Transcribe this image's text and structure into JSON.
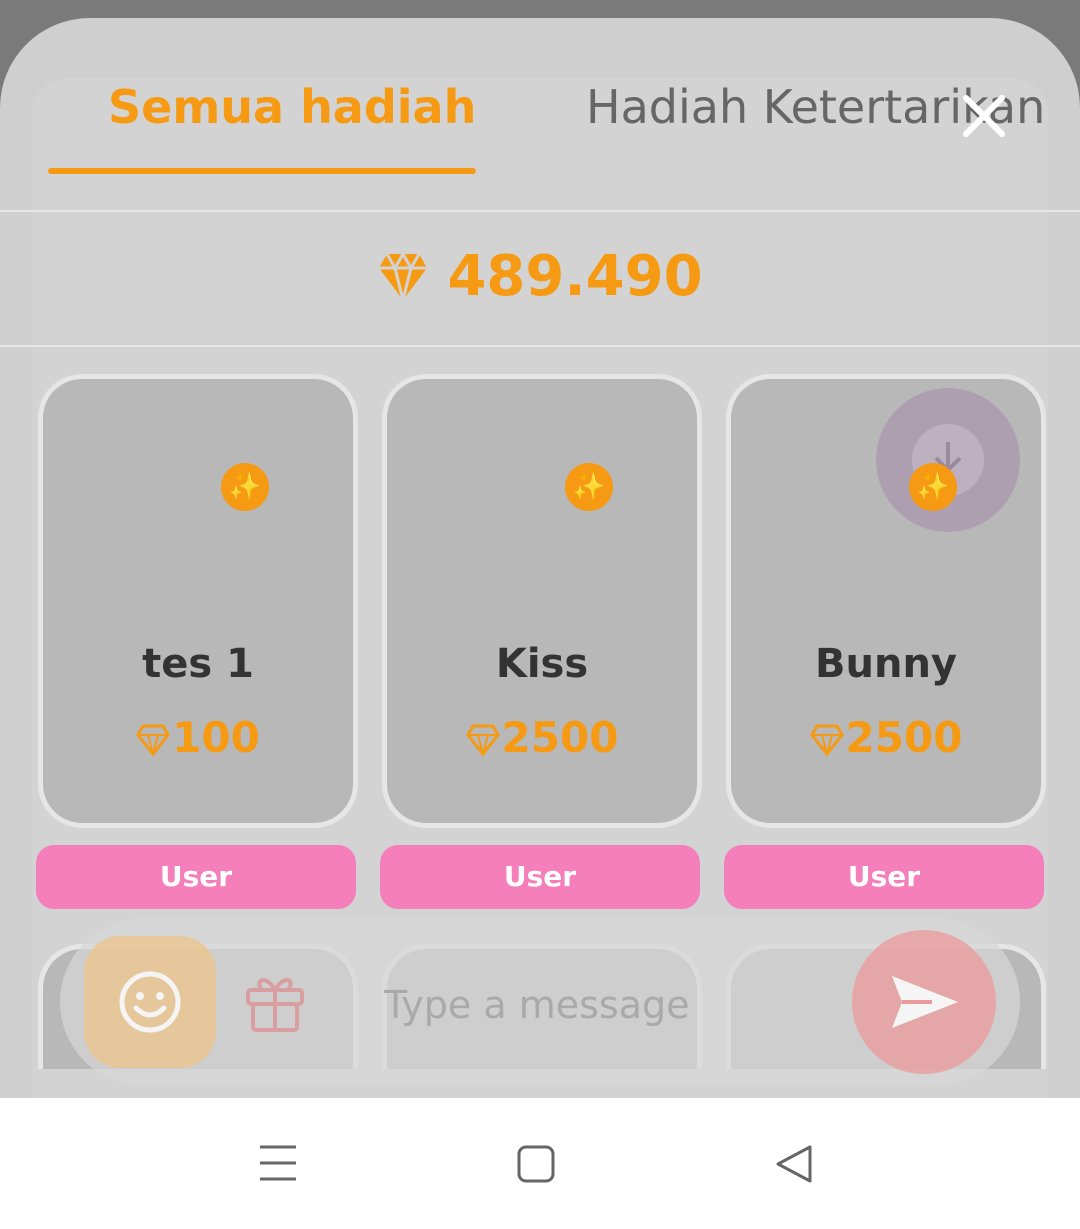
{
  "tabs": [
    {
      "label": "Semua hadiah",
      "active": true
    },
    {
      "label": "Hadiah Ketertarikan",
      "active": false
    }
  ],
  "balance": {
    "amount": "489.490",
    "icon": "diamond-icon"
  },
  "gifts": [
    {
      "name": "tes 1",
      "price": "100",
      "tag": "User",
      "badge": "✨"
    },
    {
      "name": "Kiss",
      "price": "2500",
      "tag": "User",
      "badge": "✨"
    },
    {
      "name": "Bunny",
      "price": "2500",
      "tag": "User",
      "badge": "✨"
    }
  ],
  "chat": {
    "placeholder": "Type a message"
  },
  "colors": {
    "accent": "#f59a12",
    "tag": "#f47fbb",
    "send": "#ea9c9c"
  },
  "icons": [
    "close-icon",
    "diamond-icon",
    "sparkle-icon",
    "download-icon",
    "emoji-icon",
    "gift-icon",
    "send-icon",
    "menu-icon",
    "home-icon",
    "back-icon"
  ]
}
